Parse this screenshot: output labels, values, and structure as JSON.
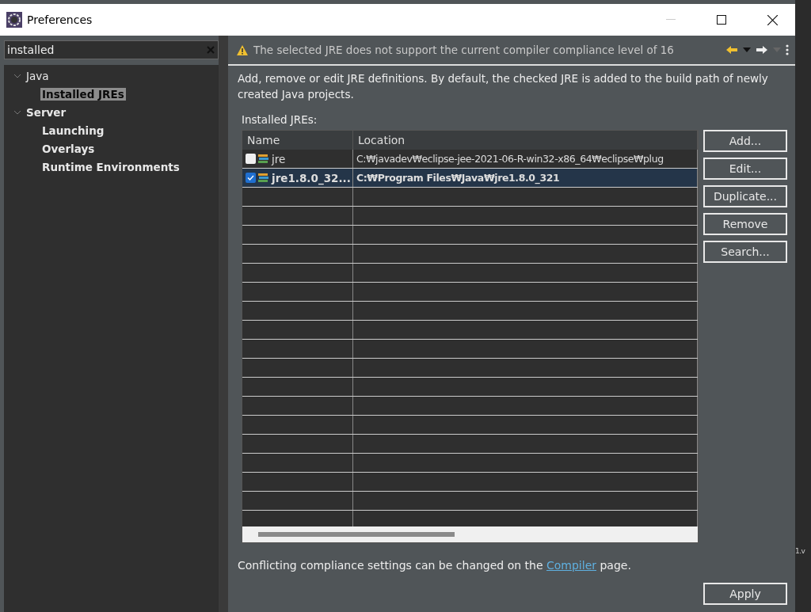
{
  "window": {
    "title": "Preferences"
  },
  "filter": {
    "value": "installed"
  },
  "tree": [
    {
      "label": "Java",
      "matched": false,
      "expanded": true,
      "selected": false,
      "children": [
        {
          "label": "Installed JREs",
          "matched": true,
          "selected": true
        }
      ]
    },
    {
      "label": "Server",
      "matched": true,
      "expanded": true,
      "selected": false,
      "children": [
        {
          "label": "Launching",
          "matched": true,
          "selected": false
        },
        {
          "label": "Overlays",
          "matched": true,
          "selected": false
        },
        {
          "label": "Runtime Environments",
          "matched": true,
          "selected": false
        }
      ]
    }
  ],
  "message": {
    "kind": "warning",
    "text": "The selected JRE does not support the current compiler compliance level of 16"
  },
  "description": "Add, remove or edit JRE definitions. By default, the checked JRE is added to the build path of newly created Java projects.",
  "table": {
    "label": "Installed JREs:",
    "columns": [
      "Name",
      "Location"
    ],
    "rows": [
      {
        "name": "jre",
        "location": "C:₩javadev₩eclipse-jee-2021-06-R-win32-x86_64₩eclipse₩plug",
        "checked": false,
        "selected": false
      },
      {
        "name": "jre1.8.0_32...",
        "location": "C:₩Program Files₩Java₩jre1.8.0_321",
        "checked": true,
        "selected": true
      }
    ]
  },
  "buttons": [
    "Add...",
    "Edit...",
    "Duplicate...",
    "Remove",
    "Search..."
  ],
  "footer": {
    "before": "Conflicting compliance settings can be changed on the ",
    "link": "Compiler",
    "after": " page."
  },
  "apply": "Apply",
  "background_text": "1.v"
}
